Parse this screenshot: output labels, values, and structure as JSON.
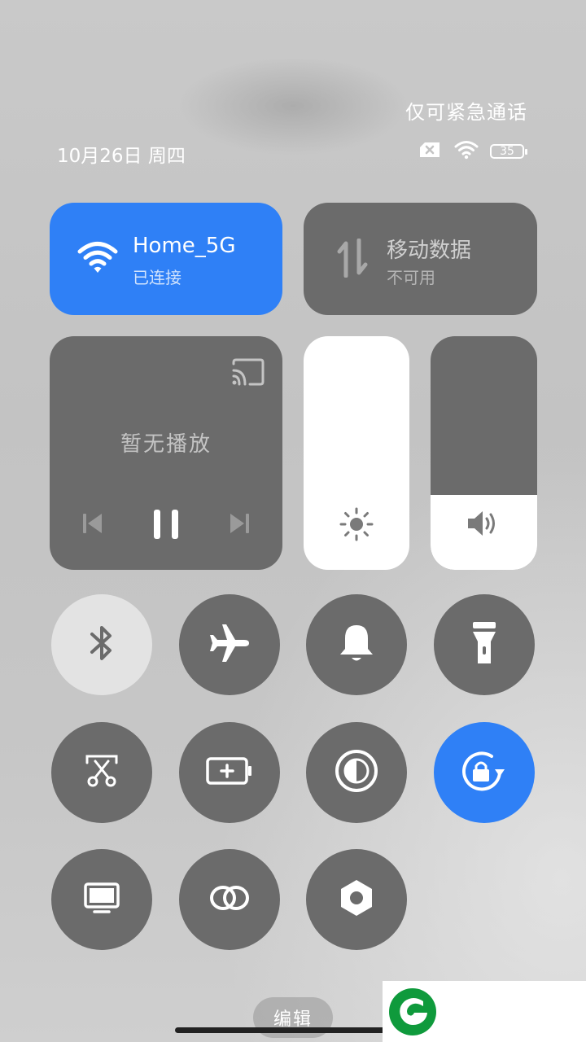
{
  "status": {
    "emergency_text": "仅可紧急通话",
    "date_text": "10月26日 周四",
    "battery_level": "35"
  },
  "wifi_tile": {
    "title": "Home_5G",
    "subtitle": "已连接",
    "active": true,
    "accent": "#2f80f6"
  },
  "mobile_tile": {
    "title": "移动数据",
    "subtitle": "不可用",
    "active": false
  },
  "media": {
    "text": "暂无播放"
  },
  "sliders": {
    "brightness_level": 1.0,
    "volume_level": 0.32
  },
  "toggles": [
    {
      "name": "bluetooth",
      "icon": "bluetooth-icon",
      "state": "on"
    },
    {
      "name": "airplane",
      "icon": "airplane-icon",
      "state": "off"
    },
    {
      "name": "silent",
      "icon": "bell-icon",
      "state": "off"
    },
    {
      "name": "flashlight",
      "icon": "flashlight-icon",
      "state": "off"
    },
    {
      "name": "screenshot",
      "icon": "screenshot-scissors-icon",
      "state": "off"
    },
    {
      "name": "battery-saver",
      "icon": "battery-plus-icon",
      "state": "off"
    },
    {
      "name": "dark-mode",
      "icon": "contrast-icon",
      "state": "off"
    },
    {
      "name": "rotation-lock",
      "icon": "rotation-lock-icon",
      "state": "on"
    },
    {
      "name": "cast-screen",
      "icon": "monitor-icon",
      "state": "off"
    },
    {
      "name": "link",
      "icon": "link-rings-icon",
      "state": "off"
    },
    {
      "name": "settings",
      "icon": "hexagon-nut-icon",
      "state": "off"
    }
  ],
  "edit_label": "编辑",
  "colors": {
    "tile_bg": "#6b6b6b",
    "accent_blue": "#2f80f6",
    "logo_green": "#0f9a3c"
  }
}
